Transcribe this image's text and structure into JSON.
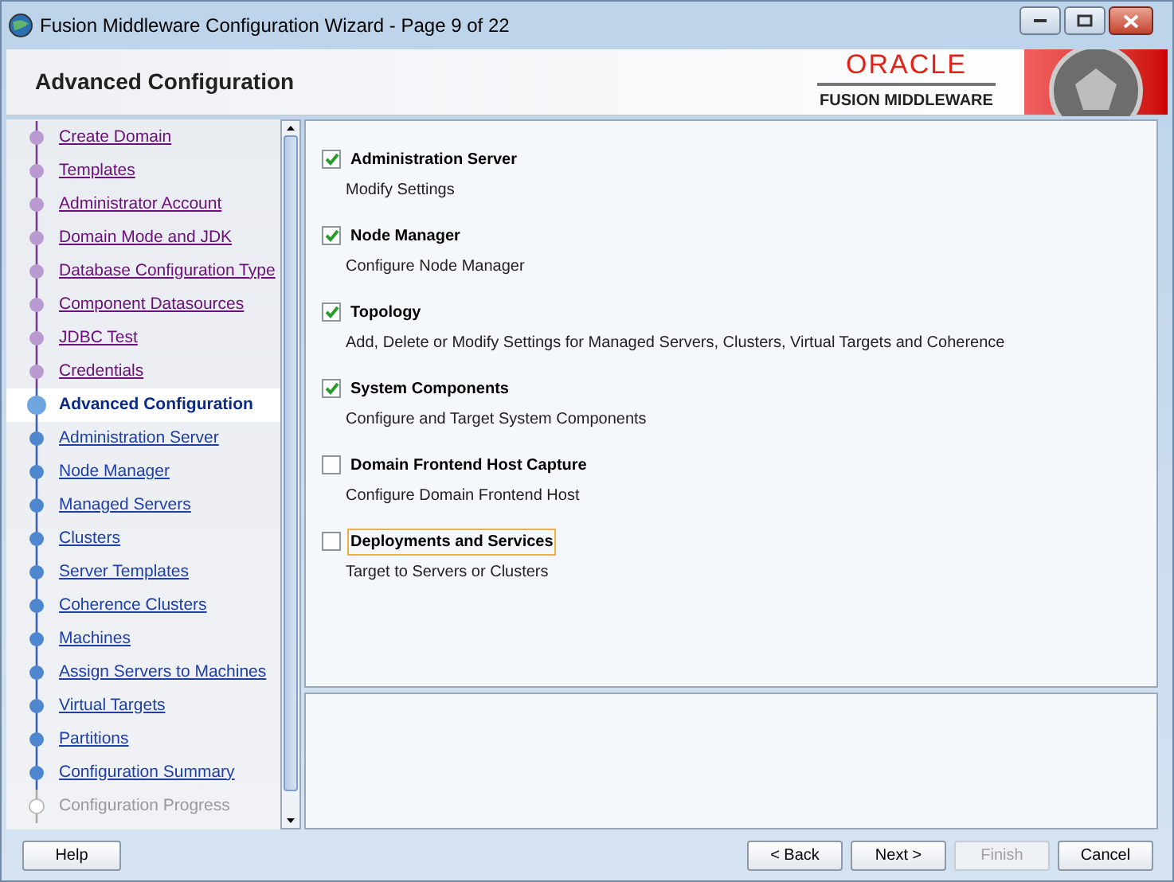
{
  "window": {
    "title": "Fusion Middleware Configuration Wizard - Page 9 of 22"
  },
  "header": {
    "title": "Advanced Configuration",
    "logo_brand": "ORACLE",
    "logo_product": "FUSION MIDDLEWARE"
  },
  "steps": [
    {
      "label": "Create Domain",
      "visited": true,
      "disabled": false,
      "selected": false
    },
    {
      "label": "Templates",
      "visited": true,
      "disabled": false,
      "selected": false
    },
    {
      "label": "Administrator Account",
      "visited": true,
      "disabled": false,
      "selected": false
    },
    {
      "label": "Domain Mode and JDK",
      "visited": true,
      "disabled": false,
      "selected": false
    },
    {
      "label": "Database Configuration Type",
      "visited": true,
      "disabled": false,
      "selected": false
    },
    {
      "label": "Component Datasources",
      "visited": true,
      "disabled": false,
      "selected": false
    },
    {
      "label": "JDBC Test",
      "visited": true,
      "disabled": false,
      "selected": false
    },
    {
      "label": "Credentials",
      "visited": true,
      "disabled": false,
      "selected": false
    },
    {
      "label": "Advanced Configuration",
      "visited": false,
      "disabled": false,
      "selected": true
    },
    {
      "label": "Administration Server",
      "visited": false,
      "disabled": false,
      "selected": false
    },
    {
      "label": "Node Manager",
      "visited": false,
      "disabled": false,
      "selected": false
    },
    {
      "label": "Managed Servers",
      "visited": false,
      "disabled": false,
      "selected": false
    },
    {
      "label": "Clusters",
      "visited": false,
      "disabled": false,
      "selected": false
    },
    {
      "label": "Server Templates",
      "visited": false,
      "disabled": false,
      "selected": false
    },
    {
      "label": "Coherence Clusters",
      "visited": false,
      "disabled": false,
      "selected": false
    },
    {
      "label": "Machines",
      "visited": false,
      "disabled": false,
      "selected": false
    },
    {
      "label": "Assign Servers to Machines",
      "visited": false,
      "disabled": false,
      "selected": false
    },
    {
      "label": "Virtual Targets",
      "visited": false,
      "disabled": false,
      "selected": false
    },
    {
      "label": "Partitions",
      "visited": false,
      "disabled": false,
      "selected": false
    },
    {
      "label": "Configuration Summary",
      "visited": false,
      "disabled": false,
      "selected": false
    },
    {
      "label": "Configuration Progress",
      "visited": false,
      "disabled": true,
      "selected": false
    }
  ],
  "options": [
    {
      "label": "Administration Server",
      "description": "Modify Settings",
      "checked": true,
      "focused": false
    },
    {
      "label": "Node Manager",
      "description": "Configure Node Manager",
      "checked": true,
      "focused": false
    },
    {
      "label": "Topology",
      "description": "Add, Delete or Modify Settings for Managed Servers, Clusters, Virtual Targets and Coherence",
      "checked": true,
      "focused": false
    },
    {
      "label": "System Components",
      "description": "Configure and Target System Components",
      "checked": true,
      "focused": false
    },
    {
      "label": "Domain Frontend Host Capture",
      "description": "Configure Domain Frontend Host",
      "checked": false,
      "focused": false
    },
    {
      "label": "Deployments and Services",
      "description": "Target to Servers or Clusters",
      "checked": false,
      "focused": true
    }
  ],
  "buttons": [
    {
      "label": "Help",
      "kind": "help",
      "disabled": false
    },
    {
      "label": "< Back",
      "kind": "nav",
      "disabled": false
    },
    {
      "label": "Next >",
      "kind": "nav",
      "disabled": false
    },
    {
      "label": "Finish",
      "kind": "nav",
      "disabled": true
    },
    {
      "label": "Cancel",
      "kind": "nav",
      "disabled": false
    }
  ]
}
